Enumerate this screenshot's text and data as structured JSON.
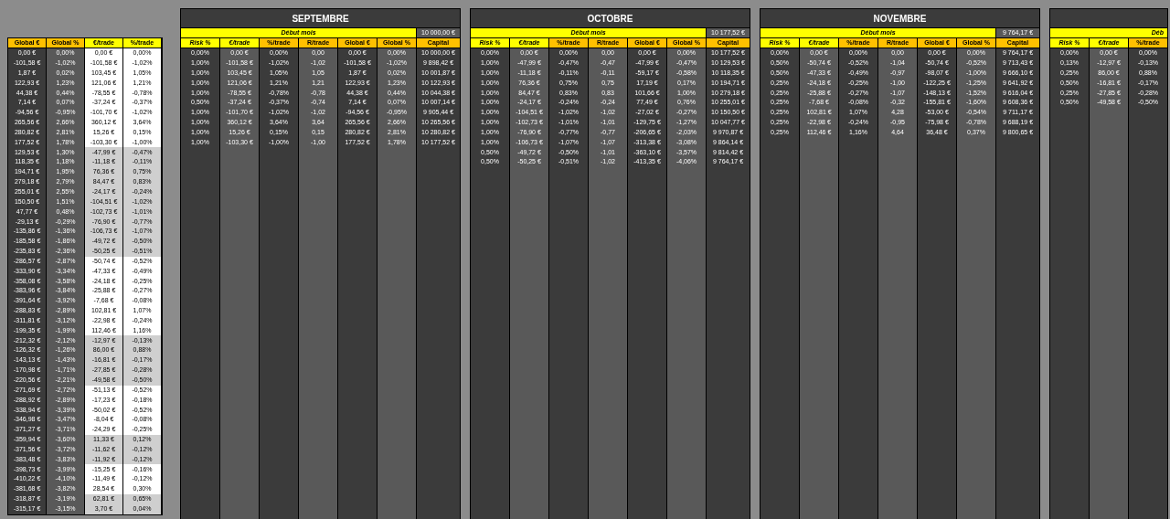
{
  "summary_table": {
    "columns": [
      {
        "label": "Global €",
        "color": "#ffc000",
        "kind": "dark"
      },
      {
        "label": "Global %",
        "color": "#ffc000",
        "kind": "medium"
      },
      {
        "label": "€/trade",
        "color": "#ffff00",
        "kind": "banded"
      },
      {
        "label": "%/trade",
        "color": "#ffff00",
        "kind": "banded"
      }
    ],
    "rows": [
      {
        "cells": [
          "0,00 €",
          "0,00%",
          "0,00 €",
          "0,00%"
        ],
        "shaded": false
      },
      {
        "cells": [
          "-101,58 €",
          "-1,02%",
          "-101,58 €",
          "-1,02%"
        ],
        "shaded": false
      },
      {
        "cells": [
          "1,87 €",
          "0,02%",
          "103,45 €",
          "1,05%"
        ],
        "shaded": false
      },
      {
        "cells": [
          "122,93 €",
          "1,23%",
          "121,06 €",
          "1,21%"
        ],
        "shaded": false
      },
      {
        "cells": [
          "44,38 €",
          "0,44%",
          "-78,55 €",
          "-0,78%"
        ],
        "shaded": false
      },
      {
        "cells": [
          "7,14 €",
          "0,07%",
          "-37,24 €",
          "-0,37%"
        ],
        "shaded": false
      },
      {
        "cells": [
          "-94,56 €",
          "-0,95%",
          "-101,70 €",
          "-1,02%"
        ],
        "shaded": false
      },
      {
        "cells": [
          "265,56 €",
          "2,66%",
          "360,12 €",
          "3,64%"
        ],
        "shaded": false
      },
      {
        "cells": [
          "280,82 €",
          "2,81%",
          "15,26 €",
          "0,15%"
        ],
        "shaded": false
      },
      {
        "cells": [
          "177,52 €",
          "1,78%",
          "-103,30 €",
          "-1,00%"
        ],
        "shaded": false
      },
      {
        "cells": [
          "129,53 €",
          "1,30%",
          "-47,99 €",
          "-0,47%"
        ],
        "shaded": true
      },
      {
        "cells": [
          "118,35 €",
          "1,18%",
          "-11,18 €",
          "-0,11%"
        ],
        "shaded": true
      },
      {
        "cells": [
          "194,71 €",
          "1,95%",
          "76,36 €",
          "0,75%"
        ],
        "shaded": true
      },
      {
        "cells": [
          "279,18 €",
          "2,79%",
          "84,47 €",
          "0,83%"
        ],
        "shaded": true
      },
      {
        "cells": [
          "255,01 €",
          "2,55%",
          "-24,17 €",
          "-0,24%"
        ],
        "shaded": true
      },
      {
        "cells": [
          "150,50 €",
          "1,51%",
          "-104,51 €",
          "-1,02%"
        ],
        "shaded": true
      },
      {
        "cells": [
          "47,77 €",
          "0,48%",
          "-102,73 €",
          "-1,01%"
        ],
        "shaded": true
      },
      {
        "cells": [
          "-29,13 €",
          "-0,29%",
          "-76,90 €",
          "-0,77%"
        ],
        "shaded": true
      },
      {
        "cells": [
          "-135,86 €",
          "-1,36%",
          "-106,73 €",
          "-1,07%"
        ],
        "shaded": true
      },
      {
        "cells": [
          "-185,58 €",
          "-1,86%",
          "-49,72 €",
          "-0,50%"
        ],
        "shaded": true
      },
      {
        "cells": [
          "-235,83 €",
          "-2,36%",
          "-50,25 €",
          "-0,51%"
        ],
        "shaded": true
      },
      {
        "cells": [
          "-286,57 €",
          "-2,87%",
          "-50,74 €",
          "-0,52%"
        ],
        "shaded": false
      },
      {
        "cells": [
          "-333,90 €",
          "-3,34%",
          "-47,33 €",
          "-0,49%"
        ],
        "shaded": false
      },
      {
        "cells": [
          "-358,08 €",
          "-3,58%",
          "-24,18 €",
          "-0,25%"
        ],
        "shaded": false
      },
      {
        "cells": [
          "-383,96 €",
          "-3,84%",
          "-25,88 €",
          "-0,27%"
        ],
        "shaded": false
      },
      {
        "cells": [
          "-391,64 €",
          "-3,92%",
          "-7,68 €",
          "-0,08%"
        ],
        "shaded": false
      },
      {
        "cells": [
          "-288,83 €",
          "-2,89%",
          "102,81 €",
          "1,07%"
        ],
        "shaded": false
      },
      {
        "cells": [
          "-311,81 €",
          "-3,12%",
          "-22,98 €",
          "-0,24%"
        ],
        "shaded": false
      },
      {
        "cells": [
          "-199,35 €",
          "-1,99%",
          "112,46 €",
          "1,16%"
        ],
        "shaded": false
      },
      {
        "cells": [
          "-212,32 €",
          "-2,12%",
          "-12,97 €",
          "-0,13%"
        ],
        "shaded": true
      },
      {
        "cells": [
          "-126,32 €",
          "-1,26%",
          "86,00 €",
          "0,88%"
        ],
        "shaded": true
      },
      {
        "cells": [
          "-143,13 €",
          "-1,43%",
          "-16,81 €",
          "-0,17%"
        ],
        "shaded": true
      },
      {
        "cells": [
          "-170,98 €",
          "-1,71%",
          "-27,85 €",
          "-0,28%"
        ],
        "shaded": true
      },
      {
        "cells": [
          "-220,56 €",
          "-2,21%",
          "-49,58 €",
          "-0,50%"
        ],
        "shaded": true
      },
      {
        "cells": [
          "-271,69 €",
          "-2,72%",
          "-51,13 €",
          "-0,52%"
        ],
        "shaded": false
      },
      {
        "cells": [
          "-288,92 €",
          "-2,89%",
          "-17,23 €",
          "-0,18%"
        ],
        "shaded": false
      },
      {
        "cells": [
          "-338,94 €",
          "-3,39%",
          "-50,02 €",
          "-0,52%"
        ],
        "shaded": false
      },
      {
        "cells": [
          "-346,98 €",
          "-3,47%",
          "-8,04 €",
          "-0,08%"
        ],
        "shaded": false
      },
      {
        "cells": [
          "-371,27 €",
          "-3,71%",
          "-24,29 €",
          "-0,25%"
        ],
        "shaded": false
      },
      {
        "cells": [
          "-359,94 €",
          "-3,60%",
          "11,33 €",
          "0,12%"
        ],
        "shaded": true
      },
      {
        "cells": [
          "-371,56 €",
          "-3,72%",
          "-11,62 €",
          "-0,12%"
        ],
        "shaded": true
      },
      {
        "cells": [
          "-383,48 €",
          "-3,83%",
          "-11,92 €",
          "-0,12%"
        ],
        "shaded": true
      },
      {
        "cells": [
          "-398,73 €",
          "-3,99%",
          "-15,25 €",
          "-0,16%"
        ],
        "shaded": false
      },
      {
        "cells": [
          "-410,22 €",
          "-4,10%",
          "-11,49 €",
          "-0,12%"
        ],
        "shaded": false
      },
      {
        "cells": [
          "-381,68 €",
          "-3,82%",
          "28,54 €",
          "0,30%"
        ],
        "shaded": false
      },
      {
        "cells": [
          "-318,87 €",
          "-3,19%",
          "62,81 €",
          "0,65%"
        ],
        "shaded": true
      },
      {
        "cells": [
          "-315,17 €",
          "-3,15%",
          "3,70 €",
          "0,04%"
        ],
        "shaded": true
      }
    ]
  },
  "months": [
    {
      "title": "SEPTEMBRE",
      "start_label": "Début mois",
      "start_capital": "10 000,00 €",
      "columns": [
        {
          "label": "Risk %",
          "color": "#ffff00",
          "kind": "dark"
        },
        {
          "label": "€/trade",
          "color": "#ffff00",
          "kind": "medium"
        },
        {
          "label": "%/trade",
          "color": "#ffc000",
          "kind": "dark"
        },
        {
          "label": "R/trade",
          "color": "#ffc000",
          "kind": "medium"
        },
        {
          "label": "Global €",
          "color": "#ffc000",
          "kind": "dark"
        },
        {
          "label": "Global %",
          "color": "#ffc000",
          "kind": "medium"
        },
        {
          "label": "Capital",
          "color": "#ffc000",
          "kind": "dark"
        }
      ],
      "rows": [
        [
          "0,00%",
          "0,00 €",
          "0,00%",
          "0,00",
          "0,00 €",
          "0,00%",
          "10 000,00 €"
        ],
        [
          "1,00%",
          "-101,58 €",
          "-1,02%",
          "-1,02",
          "-101,58 €",
          "-1,02%",
          "9 898,42 €"
        ],
        [
          "1,00%",
          "103,45 €",
          "1,05%",
          "1,05",
          "1,87 €",
          "0,02%",
          "10 001,87 €"
        ],
        [
          "1,00%",
          "121,06 €",
          "1,21%",
          "1,21",
          "122,93 €",
          "1,23%",
          "10 122,93 €"
        ],
        [
          "1,00%",
          "-78,55 €",
          "-0,78%",
          "-0,78",
          "44,38 €",
          "0,44%",
          "10 044,38 €"
        ],
        [
          "0,50%",
          "-37,24 €",
          "-0,37%",
          "-0,74",
          "7,14 €",
          "0,07%",
          "10 007,14 €"
        ],
        [
          "1,00%",
          "-101,70 €",
          "-1,02%",
          "-1,02",
          "-94,56 €",
          "-0,95%",
          "9 905,44 €"
        ],
        [
          "1,00%",
          "360,12 €",
          "3,64%",
          "3,64",
          "265,56 €",
          "2,66%",
          "10 265,56 €"
        ],
        [
          "1,00%",
          "15,26 €",
          "0,15%",
          "0,15",
          "280,82 €",
          "2,81%",
          "10 280,82 €"
        ],
        [
          "1,00%",
          "-103,30 €",
          "-1,00%",
          "-1,00",
          "177,52 €",
          "1,78%",
          "10 177,52 €"
        ]
      ]
    },
    {
      "title": "OCTOBRE",
      "start_label": "Début mois",
      "start_capital": "10 177,52 €",
      "columns": [
        {
          "label": "Risk %",
          "color": "#ffff00",
          "kind": "dark"
        },
        {
          "label": "€/trade",
          "color": "#ffff00",
          "kind": "medium"
        },
        {
          "label": "%/trade",
          "color": "#ffc000",
          "kind": "dark"
        },
        {
          "label": "R/trade",
          "color": "#ffc000",
          "kind": "medium"
        },
        {
          "label": "Global €",
          "color": "#ffc000",
          "kind": "dark"
        },
        {
          "label": "Global %",
          "color": "#ffc000",
          "kind": "medium"
        },
        {
          "label": "Capital",
          "color": "#ffc000",
          "kind": "dark"
        }
      ],
      "rows": [
        [
          "0,00%",
          "0,00 €",
          "0,00%",
          "0,00",
          "0,00 €",
          "0,00%",
          "10 177,52 €"
        ],
        [
          "1,00%",
          "-47,99 €",
          "-0,47%",
          "-0,47",
          "-47,99 €",
          "-0,47%",
          "10 129,53 €"
        ],
        [
          "1,00%",
          "-11,18 €",
          "-0,11%",
          "-0,11",
          "-59,17 €",
          "-0,58%",
          "10 118,35 €"
        ],
        [
          "1,00%",
          "76,36 €",
          "0,75%",
          "0,75",
          "17,19 €",
          "0,17%",
          "10 194,71 €"
        ],
        [
          "1,00%",
          "84,47 €",
          "0,83%",
          "0,83",
          "101,66 €",
          "1,00%",
          "10 279,18 €"
        ],
        [
          "1,00%",
          "-24,17 €",
          "-0,24%",
          "-0,24",
          "77,49 €",
          "0,76%",
          "10 255,01 €"
        ],
        [
          "1,00%",
          "-104,51 €",
          "-1,02%",
          "-1,02",
          "-27,02 €",
          "-0,27%",
          "10 150,50 €"
        ],
        [
          "1,00%",
          "-102,73 €",
          "-1,01%",
          "-1,01",
          "-129,75 €",
          "-1,27%",
          "10 047,77 €"
        ],
        [
          "1,00%",
          "-76,90 €",
          "-0,77%",
          "-0,77",
          "-206,65 €",
          "-2,03%",
          "9 970,87 €"
        ],
        [
          "1,00%",
          "-106,73 €",
          "-1,07%",
          "-1,07",
          "-313,38 €",
          "-3,08%",
          "9 864,14 €"
        ],
        [
          "0,50%",
          "-49,72 €",
          "-0,50%",
          "-1,01",
          "-363,10 €",
          "-3,57%",
          "9 814,42 €"
        ],
        [
          "0,50%",
          "-50,25 €",
          "-0,51%",
          "-1,02",
          "-413,35 €",
          "-4,06%",
          "9 764,17 €"
        ]
      ]
    },
    {
      "title": "NOVEMBRE",
      "start_label": "Début mois",
      "start_capital": "9 764,17 €",
      "columns": [
        {
          "label": "Risk %",
          "color": "#ffff00",
          "kind": "dark"
        },
        {
          "label": "€/trade",
          "color": "#ffff00",
          "kind": "medium"
        },
        {
          "label": "%/trade",
          "color": "#ffc000",
          "kind": "dark"
        },
        {
          "label": "R/trade",
          "color": "#ffc000",
          "kind": "medium"
        },
        {
          "label": "Global €",
          "color": "#ffc000",
          "kind": "dark"
        },
        {
          "label": "Global %",
          "color": "#ffc000",
          "kind": "medium"
        },
        {
          "label": "Capital",
          "color": "#ffc000",
          "kind": "dark"
        }
      ],
      "rows": [
        [
          "0,00%",
          "0,00 €",
          "0,00%",
          "0,00",
          "0,00 €",
          "0,00%",
          "9 764,17 €"
        ],
        [
          "0,50%",
          "-50,74 €",
          "-0,52%",
          "-1,04",
          "-50,74 €",
          "-0,52%",
          "9 713,43 €"
        ],
        [
          "0,50%",
          "-47,33 €",
          "-0,49%",
          "-0,97",
          "-98,07 €",
          "-1,00%",
          "9 666,10 €"
        ],
        [
          "0,25%",
          "-24,18 €",
          "-0,25%",
          "-1,00",
          "-122,25 €",
          "-1,25%",
          "9 641,92 €"
        ],
        [
          "0,25%",
          "-25,88 €",
          "-0,27%",
          "-1,07",
          "-148,13 €",
          "-1,52%",
          "9 616,04 €"
        ],
        [
          "0,25%",
          "-7,68 €",
          "-0,08%",
          "-0,32",
          "-155,81 €",
          "-1,60%",
          "9 608,36 €"
        ],
        [
          "0,25%",
          "102,81 €",
          "1,07%",
          "4,28",
          "-53,00 €",
          "-0,54%",
          "9 711,17 €"
        ],
        [
          "0,25%",
          "-22,98 €",
          "-0,24%",
          "-0,95",
          "-75,98 €",
          "-0,78%",
          "9 688,19 €"
        ],
        [
          "0,25%",
          "112,46 €",
          "1,16%",
          "4,64",
          "36,48 €",
          "0,37%",
          "9 800,65 €"
        ]
      ]
    },
    {
      "start_label": "Déb",
      "columns": [
        {
          "label": "Risk %",
          "color": "#ffff00",
          "kind": "dark"
        },
        {
          "label": "€/trade",
          "color": "#ffff00",
          "kind": "medium"
        },
        {
          "label": "%/trade",
          "color": "#ffc000",
          "kind": "dark"
        }
      ],
      "rows": [
        [
          "0,00%",
          "0,00 €",
          "0,00%"
        ],
        [
          "0,13%",
          "-12,97 €",
          "-0,13%"
        ],
        [
          "0,25%",
          "86,00 €",
          "0,88%"
        ],
        [
          "0,50%",
          "-16,81 €",
          "-0,17%"
        ],
        [
          "0,25%",
          "-27,85 €",
          "-0,28%"
        ],
        [
          "0,50%",
          "-49,58 €",
          "-0,50%"
        ]
      ]
    }
  ]
}
